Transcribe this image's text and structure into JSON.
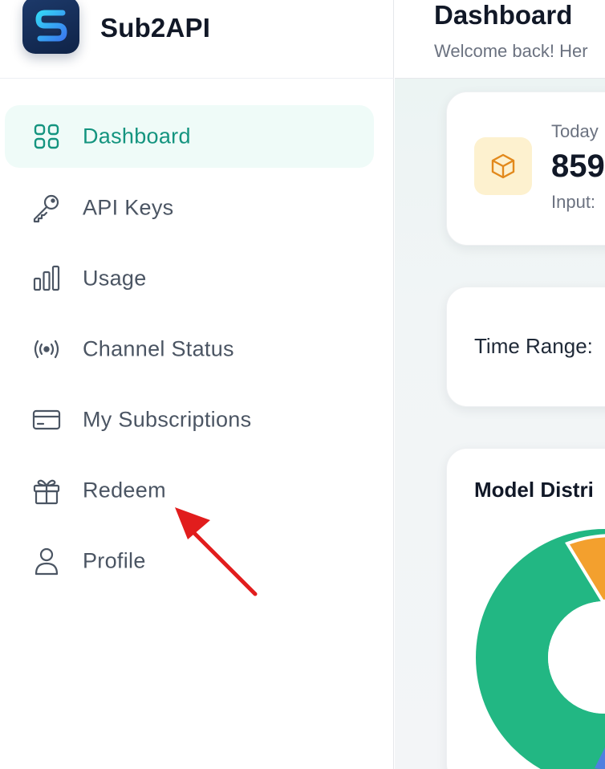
{
  "brand": {
    "name": "Sub2API"
  },
  "nav": [
    {
      "label": "Dashboard",
      "icon": "grid-icon",
      "active": true
    },
    {
      "label": "API Keys",
      "icon": "key-icon",
      "active": false
    },
    {
      "label": "Usage",
      "icon": "bar-chart-icon",
      "active": false
    },
    {
      "label": "Channel Status",
      "icon": "broadcast-icon",
      "active": false
    },
    {
      "label": "My Subscriptions",
      "icon": "credit-card-icon",
      "active": false
    },
    {
      "label": "Redeem",
      "icon": "gift-icon",
      "active": false
    },
    {
      "label": "Profile",
      "icon": "user-icon",
      "active": false
    }
  ],
  "header": {
    "title": "Dashboard",
    "subtitle": "Welcome back! Her"
  },
  "stat_card": {
    "label": "Today",
    "value": "859",
    "sub": "Input:",
    "icon": "cube-icon"
  },
  "time_range": {
    "label": "Time Range:"
  },
  "model_chart": {
    "title": "Model Distri",
    "colors": [
      "#22b783",
      "#f3a02e",
      "#4f7fe0"
    ]
  },
  "colors": {
    "accent": "#14947f",
    "active_bg": "#effbf8",
    "annotation": "#e11d1d"
  }
}
